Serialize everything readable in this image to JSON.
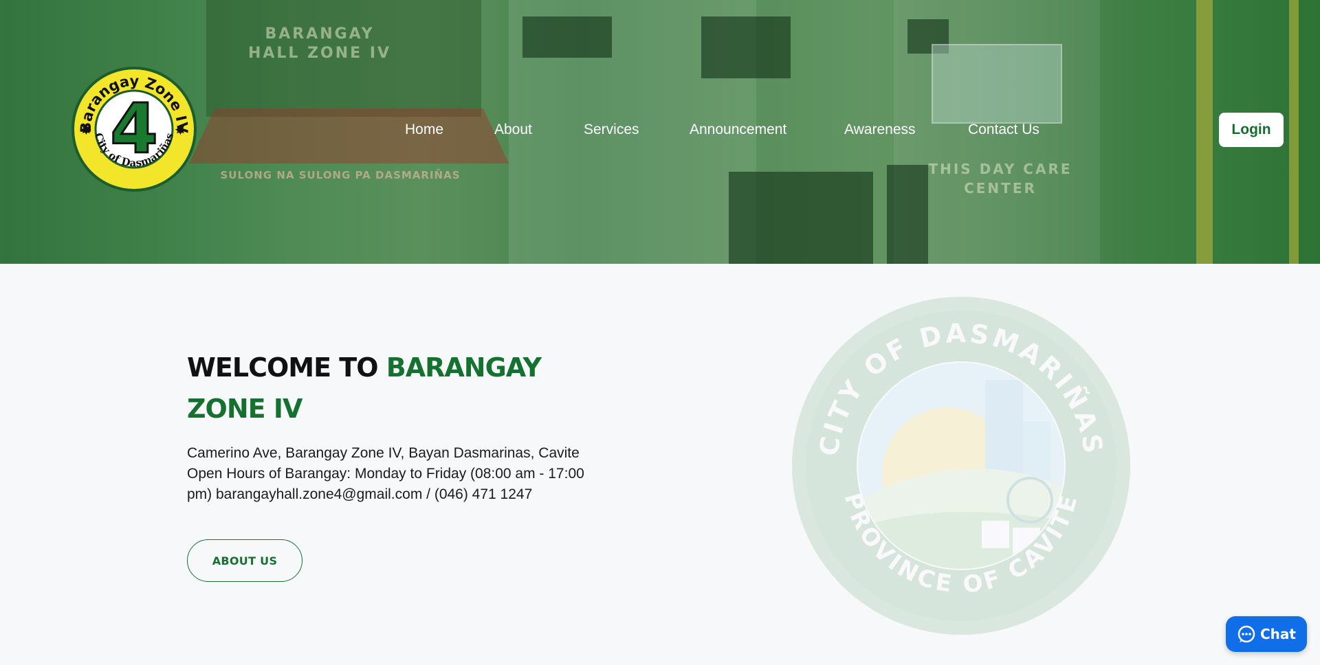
{
  "logo": {
    "ring_text_top": "Barangay Zone IV",
    "ring_text_bottom": "City of Dasmariñas",
    "number": "4"
  },
  "nav": {
    "items": [
      {
        "label": "Home"
      },
      {
        "label": "About"
      },
      {
        "label": "Services"
      },
      {
        "label": "Announcement"
      },
      {
        "label": "Awareness"
      },
      {
        "label": "Contact Us"
      }
    ],
    "login_label": "Login"
  },
  "hero_photo_signs": {
    "hall_sign": "BARANGAY HALL ZONE IV",
    "daycare_sign": "THIS DAY CARE CENTER",
    "tent_text": "SULONG NA SULONG PA DASMARIÑAS"
  },
  "welcome": {
    "title_prefix": "WELCOME TO ",
    "title_highlight": "BARANGAY ZONE IV",
    "address": "Camerino Ave, Barangay Zone IV, Bayan Dasmarinas, Cavite Open Hours of Barangay: Monday to Friday (08:00 am - 17:00 pm) barangayhall.zone4@gmail.com / (046) 471 1247",
    "button_label": "ABOUT US"
  },
  "seal": {
    "text_top": "CITY OF DASMARIÑAS",
    "text_bottom": "PROVINCE OF CAVITE"
  },
  "chat": {
    "label": "Chat"
  },
  "colors": {
    "brand_green": "#14712f",
    "hero_overlay": "#227834",
    "chat_blue": "#0f6ee8",
    "logo_yellow": "#f3e52a"
  }
}
